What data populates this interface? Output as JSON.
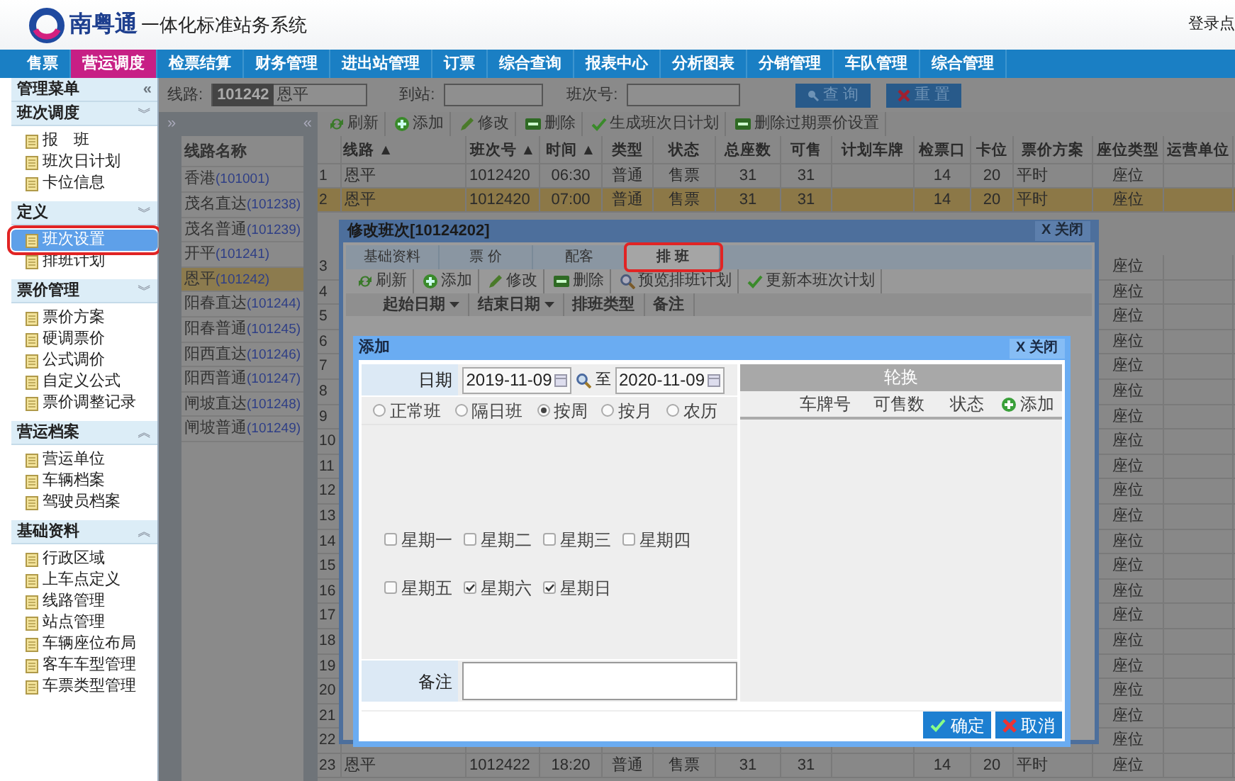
{
  "header": {
    "brand": "南粤通",
    "title": "一体化标准站务系统",
    "login": "登录点"
  },
  "nav": [
    {
      "label": "售票",
      "selected": false
    },
    {
      "label": "营运调度",
      "selected": true
    },
    {
      "label": "检票结算",
      "selected": false
    },
    {
      "label": "财务管理",
      "selected": false
    },
    {
      "label": "进出站管理",
      "selected": false
    },
    {
      "label": "订票",
      "selected": false
    },
    {
      "label": "综合查询",
      "selected": false
    },
    {
      "label": "报表中心",
      "selected": false
    },
    {
      "label": "分析图表",
      "selected": false
    },
    {
      "label": "分销管理",
      "selected": false
    },
    {
      "label": "车队管理",
      "selected": false
    },
    {
      "label": "综合管理",
      "selected": false
    }
  ],
  "sidebar": {
    "title": "管理菜单",
    "collapse": "«",
    "sections": [
      {
        "title": "班次调度",
        "chevron": "︾",
        "items": [
          {
            "label": "报　班",
            "selected": false,
            "annotated": false
          },
          {
            "label": "班次日计划",
            "selected": false,
            "annotated": false
          },
          {
            "label": "卡位信息",
            "selected": false,
            "annotated": false
          }
        ]
      },
      {
        "title": "定义",
        "chevron": "︾",
        "items": [
          {
            "label": "班次设置",
            "selected": true,
            "annotated": true
          },
          {
            "label": "排班计划",
            "selected": false,
            "annotated": false
          }
        ]
      },
      {
        "title": "票价管理",
        "chevron": "︾",
        "items": [
          {
            "label": "票价方案",
            "selected": false,
            "annotated": false
          },
          {
            "label": "硬调票价",
            "selected": false,
            "annotated": false
          },
          {
            "label": "公式调价",
            "selected": false,
            "annotated": false
          },
          {
            "label": "自定义公式",
            "selected": false,
            "annotated": false
          },
          {
            "label": "票价调整记录",
            "selected": false,
            "annotated": false
          }
        ]
      },
      {
        "title": "营运档案",
        "chevron": "︽",
        "items": [
          {
            "label": "营运单位",
            "selected": false,
            "annotated": false
          },
          {
            "label": "车辆档案",
            "selected": false,
            "annotated": false
          },
          {
            "label": "驾驶员档案",
            "selected": false,
            "annotated": false
          }
        ]
      },
      {
        "title": "基础资料",
        "chevron": "︽",
        "items": [
          {
            "label": "行政区域",
            "selected": false,
            "annotated": false
          },
          {
            "label": "上车点定义",
            "selected": false,
            "annotated": false
          },
          {
            "label": "线路管理",
            "selected": false,
            "annotated": false
          },
          {
            "label": "站点管理",
            "selected": false,
            "annotated": false
          },
          {
            "label": "车辆座位布局",
            "selected": false,
            "annotated": false
          },
          {
            "label": "客车车型管理",
            "selected": false,
            "annotated": false
          },
          {
            "label": "车票类型管理",
            "selected": false,
            "annotated": false
          }
        ]
      }
    ]
  },
  "search": {
    "route_label": "线路:",
    "route_code": "101242",
    "route_name": "恩平",
    "station_label": "到站:",
    "trip_label": "班次号:",
    "buttons": [
      {
        "label": "查 询",
        "kind": "search"
      },
      {
        "label": "重 置",
        "kind": "reset"
      }
    ]
  },
  "route_list": {
    "expand": "»",
    "collapse": "«",
    "heading": "线路名称",
    "items": [
      {
        "name": "香港",
        "code": "(101001)",
        "selected": false
      },
      {
        "name": "茂名直达",
        "code": "(101238)",
        "selected": false
      },
      {
        "name": "茂名普通",
        "code": "(101239)",
        "selected": false
      },
      {
        "name": "开平",
        "code": "(101241)",
        "selected": false
      },
      {
        "name": "恩平",
        "code": "(101242)",
        "selected": true
      },
      {
        "name": "阳春直达",
        "code": "(101244)",
        "selected": false
      },
      {
        "name": "阳春普通",
        "code": "(101245)",
        "selected": false
      },
      {
        "name": "阳西直达",
        "code": "(101246)",
        "selected": false
      },
      {
        "name": "阳西普通",
        "code": "(101247)",
        "selected": false
      },
      {
        "name": "闸坡直达",
        "code": "(101248)",
        "selected": false
      },
      {
        "name": "闸坡普通",
        "code": "(101249)",
        "selected": false
      }
    ]
  },
  "grid": {
    "toolbar": [
      {
        "label": "刷新",
        "kind": "refresh"
      },
      {
        "label": "添加",
        "kind": "add"
      },
      {
        "label": "修改",
        "kind": "edit"
      },
      {
        "label": "删除",
        "kind": "delete"
      },
      {
        "label": "生成班次日计划",
        "kind": "check"
      },
      {
        "label": "删除过期票价设置",
        "kind": "delete"
      }
    ],
    "columns": [
      "线路 ▲",
      "班次号 ▲",
      "时间 ▲",
      "类型",
      "状态",
      "总座数",
      "可售",
      "计划车牌",
      "检票口",
      "卡位",
      "票价方案",
      "座位类型",
      "运营单位"
    ],
    "rows": [
      {
        "number": "1",
        "selected": false,
        "values": [
          "恩平",
          "1012420",
          "06:30",
          "普通",
          "售票",
          "31",
          "31",
          "14",
          "20",
          "平时"
        ],
        "seat_type": "座位"
      },
      {
        "number": "2",
        "selected": true,
        "values": [
          "恩平",
          "1012420",
          "07:00",
          "普通",
          "售票",
          "31",
          "31",
          "14",
          "20",
          "平时"
        ],
        "seat_type": "座位"
      },
      {
        "number": "3",
        "selected": false,
        "seat_type": "座位"
      },
      {
        "number": "4",
        "selected": false,
        "seat_type": "座位"
      },
      {
        "number": "5",
        "selected": false,
        "seat_type": "座位"
      },
      {
        "number": "6",
        "selected": false,
        "seat_type": "座位"
      },
      {
        "number": "7",
        "selected": false,
        "seat_type": "座位"
      },
      {
        "number": "8",
        "selected": false,
        "seat_type": "座位"
      },
      {
        "number": "9",
        "selected": false,
        "seat_type": "座位"
      },
      {
        "number": "10",
        "selected": false,
        "seat_type": "座位"
      },
      {
        "number": "11",
        "selected": false,
        "seat_type": "座位"
      },
      {
        "number": "12",
        "selected": false,
        "seat_type": "座位"
      },
      {
        "number": "13",
        "selected": false,
        "seat_type": "座位"
      },
      {
        "number": "14",
        "selected": false,
        "seat_type": "座位"
      },
      {
        "number": "15",
        "selected": false,
        "seat_type": "座位"
      },
      {
        "number": "16",
        "selected": false,
        "seat_type": "座位"
      },
      {
        "number": "17",
        "selected": false,
        "seat_type": "座位"
      },
      {
        "number": "18",
        "selected": false,
        "seat_type": "座位"
      },
      {
        "number": "19",
        "selected": false,
        "seat_type": "座位"
      },
      {
        "number": "20",
        "selected": false,
        "seat_type": "座位"
      },
      {
        "number": "21",
        "selected": false,
        "seat_type": "座位"
      },
      {
        "number": "22",
        "selected": false,
        "seat_type": "座位"
      },
      {
        "number": "23",
        "selected": false,
        "values": [
          "恩平",
          "1012422",
          "18:20",
          "普通",
          "售票",
          "31",
          "31",
          "14",
          "20",
          "平时"
        ],
        "seat_type": "座位"
      }
    ]
  },
  "edit_dialog": {
    "title": "修改班次[10124202]",
    "close": "X 关闭",
    "tabs": [
      {
        "label": "基础资料",
        "selected": false,
        "annotated": false
      },
      {
        "label": "票 价",
        "selected": false,
        "annotated": false
      },
      {
        "label": "配客",
        "selected": false,
        "annotated": false
      },
      {
        "label": "排 班",
        "selected": true,
        "annotated": true
      }
    ],
    "toolbar": [
      {
        "label": "刷新",
        "kind": "refresh"
      },
      {
        "label": "添加",
        "kind": "add"
      },
      {
        "label": "修改",
        "kind": "edit"
      },
      {
        "label": "删除",
        "kind": "delete"
      },
      {
        "label": "预览排班计划",
        "kind": "preview"
      },
      {
        "label": "更新本班次计划",
        "kind": "check"
      }
    ],
    "columns": [
      {
        "label": "起始日期",
        "sortable": true
      },
      {
        "label": "结束日期",
        "sortable": true
      },
      {
        "label": "排班类型",
        "sortable": false
      },
      {
        "label": "备注",
        "sortable": false
      }
    ]
  },
  "add_dialog": {
    "title": "添加",
    "close": "X 关闭",
    "date_label": "日期",
    "date_from": "2019-11-09",
    "date_sep": "至",
    "date_to": "2020-11-09",
    "modes": [
      {
        "label": "正常班",
        "selected": false
      },
      {
        "label": "隔日班",
        "selected": false
      },
      {
        "label": "按周",
        "selected": true
      },
      {
        "label": "按月",
        "selected": false
      },
      {
        "label": "农历",
        "selected": false
      }
    ],
    "weekdays": [
      {
        "label": "星期一",
        "checked": false
      },
      {
        "label": "星期二",
        "checked": false
      },
      {
        "label": "星期三",
        "checked": false
      },
      {
        "label": "星期四",
        "checked": false
      },
      {
        "label": "星期五",
        "checked": false
      },
      {
        "label": "星期六",
        "checked": true
      },
      {
        "label": "星期日",
        "checked": true
      }
    ],
    "note_label": "备注",
    "rotation": {
      "title": "轮换",
      "columns": [
        "车牌号",
        "可售数",
        "状态"
      ],
      "add": "添加"
    },
    "buttons": [
      {
        "label": "确定",
        "kind": "ok"
      },
      {
        "label": "取消",
        "kind": "cancel"
      }
    ]
  }
}
